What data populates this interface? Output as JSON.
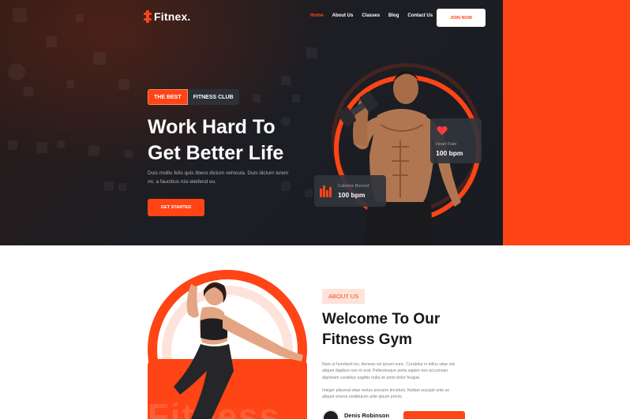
{
  "brand": {
    "name": "Fitnex.",
    "accent": "#ff4416",
    "dark": "#1c1e24"
  },
  "nav": {
    "items": [
      {
        "label": "Home",
        "active": true
      },
      {
        "label": "About Us",
        "active": false
      },
      {
        "label": "Classes",
        "active": false
      },
      {
        "label": "Blog",
        "active": false
      },
      {
        "label": "Contact Us",
        "active": false
      }
    ],
    "cta_label": "JOIN NOW"
  },
  "hero": {
    "badge_primary": "THE BEST",
    "badge_secondary": "FITNESS CLUB",
    "title_line1": "Work Hard To",
    "title_line2": "Get Better Life",
    "description_line1": "Duis mollis felis quis libero dictum vehicula. Duis dictum lorem",
    "description_line2": "mi, a faucibus nisi eleifend eu.",
    "cta_label": "GET STARTED",
    "stats": {
      "heart_rate": {
        "label": "Heart Rate",
        "value": "100 bpm",
        "icon": "heart-icon"
      },
      "calories": {
        "label": "Calories Burned",
        "value": "100 bpm",
        "icon": "bar-chart-icon"
      }
    }
  },
  "about": {
    "tag": "ABOUT US",
    "title_line1": "Welcome To Our",
    "title_line2": "Fitness Gym",
    "paragraph1_line1": "Nam ut hendrerit leo. Aenean vel ipsum nunc. Curabitur in tellus vitae nisi",
    "paragraph1_line2": "aliquet dapibus non et erat. Pellentesque porta sapien non accumsan",
    "paragraph1_line3": "dignissim curabitur sagittis nulla sit amet dolor feugiat.",
    "paragraph2_line1": "Integer placerat vitae metus posuere tincidunt. Nullam suscipit ante ac",
    "paragraph2_line2": "aliquet viverra vestibulum ante ipsum primis.",
    "author_name": "Denis Robinson",
    "ghost_word": "Fitness"
  }
}
